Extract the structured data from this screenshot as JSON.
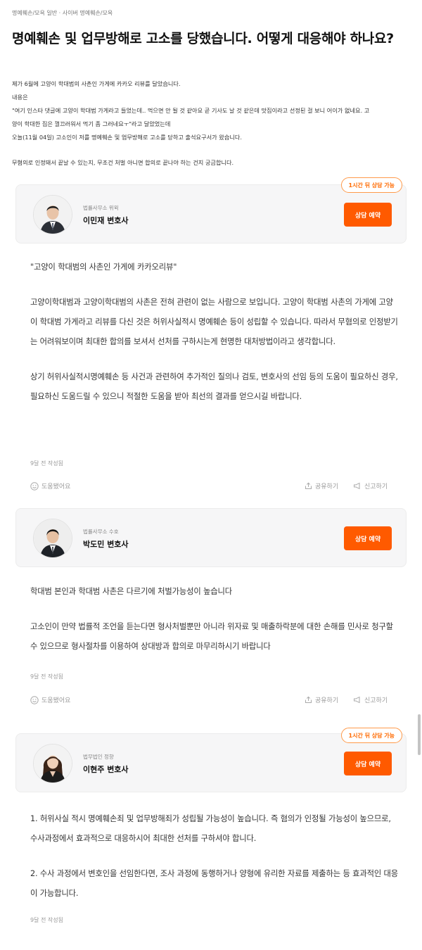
{
  "breadcrumb": "명예훼손/모욕 일반 · 사이버 명예훼손/모욕",
  "question": {
    "title": "명예훼손 및 업무방해로 고소를 당했습니다. 어떻게 대응해야 하나요?",
    "body": [
      "제가 6월에 고양이 학대범의 사촌인 가게에 카카오 리뷰를 달았습니다.",
      "내용은",
      "\"여기 인스타 댓글에 고양이 학대범 가게라고 들었는데.. 먹으면 안 될 것 같아요 곧 기사도 날 것 같은데 맛집이라고 선정된 걸 보니 어이가 없네요. 고",
      "양이 학대한 집은 껄끄러워서 먹기 좀 그러네요ㅜ\"라고 달았었는데",
      "오늘(11월 04일) 고소인이 저를 명예훼손 및 업무방해로 고소를 당하고 출석요구서가 왔습니다.",
      "무혐의로 인정돼서 끝날 수 있는지, 무조건 처벌 아니면 합의로 끝나야 하는 건지 궁금합니다."
    ]
  },
  "answers": [
    {
      "badge": "1시간 뒤 상담 가능",
      "firm": "법률사무소 위윅",
      "lawyer": "이민재 변호사",
      "cta": "상담 예약",
      "paragraphs": [
        "\"고양이 학대범의 사촌인 가게에 카카오리뷰\"",
        "고양이학대범과 고양이학대범의 사촌은 전혀 관련이 없는 사람으로 보입니다. 고양이 학대범 사촌의 가게에 고양이 학대범 가게라고 리뷰를 다신 것은 허위사실적시 명예훼손 등이 성립할 수 있습니다. 따라서 무혐의로 인정받기는 어려워보이며 최대한 합의를 보셔서 선처를 구하시는게 현명한 대처방법이라고 생각합니다.",
        "상기 허위사실적시명예훼손 등 사건과 관련하여 추가적인 질의나 검토, 변호사의 선임 등의 도움이 필요하신 경우, 필요하신 도움드릴 수 있으니 적절한 도움을 받아 최선의 결과를 얻으시길 바랍니다."
      ],
      "time": "9달 전 작성됨",
      "helpful": "도움됐어요",
      "share": "공유하기",
      "report": "신고하기"
    },
    {
      "firm": "법률사무소 수호",
      "lawyer": "박도민 변호사",
      "cta": "상담 예약",
      "paragraphs": [
        "학대범 본인과 학대범 사촌은 다르기에 처벌가능성이 높습니다",
        "고소인이 만약 법률적 조언을 듣는다면 형사처벌뿐만 아니라 위자료 및 매출하락분에 대한 손해를 민사로 청구할 수 있으므로 형사절차를 이용하여 상대방과 합의로 마무리하시기 바랍니다"
      ],
      "time": "9달 전 작성됨",
      "helpful": "도움됐어요",
      "share": "공유하기",
      "report": "신고하기"
    },
    {
      "badge": "1시간 뒤 상담 가능",
      "firm": "법무법인 정향",
      "lawyer": "이현주 변호사",
      "cta": "상담 예약",
      "paragraphs": [
        "1. 허위사실 적시 명예훼손죄 및 업무방해죄가 성립될 가능성이 높습니다. 즉 혐의가 인정될 가능성이 높으므로, 수사과정에서 효과적으로 대응하시어 최대한 선처를 구하셔야 합니다.",
        "2. 수사 과정에서 변호인을 선임한다면, 조사 과정에 동행하거나 양형에 유리한 자료를 제출하는 등 효과적인 대응이 가능합니다."
      ],
      "time": "9달 전 작성됨"
    }
  ],
  "colors": {
    "accent": "#ff5a00",
    "card_bg": "#f6f6f7"
  }
}
